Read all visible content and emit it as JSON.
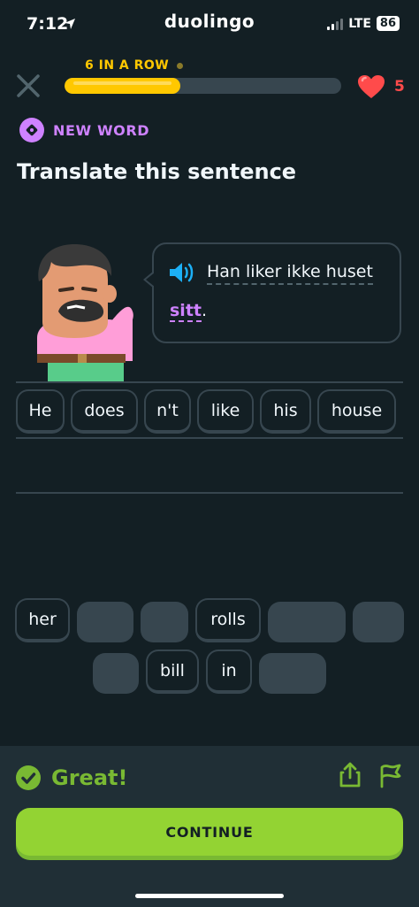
{
  "status_bar": {
    "time": "7:12",
    "carrier": "duolingo",
    "network": "LTE",
    "battery": "86"
  },
  "header": {
    "streak_label": "6 IN A ROW",
    "progress": 0.42,
    "hearts": "5"
  },
  "badge": {
    "label": "NEW WORD"
  },
  "prompt": {
    "title": "Translate this sentence"
  },
  "bubble": {
    "line1": "Han liker ikke huset",
    "highlight": "sitt",
    "punct": "."
  },
  "answer_words": [
    "He",
    "does",
    "n't",
    "like",
    "his",
    "house"
  ],
  "bank_row1": [
    "her",
    "",
    "",
    "rolls",
    "",
    ""
  ],
  "bank_row2": [
    "",
    "bill",
    "in",
    ""
  ],
  "footer": {
    "result": "Great!",
    "continue_label": "CONTINUE"
  },
  "colors": {
    "accent_yellow": "#ffc800",
    "purple": "#ce82ff",
    "green": "#93d333",
    "heart": "#ff4b4b",
    "bg": "#131f24"
  }
}
